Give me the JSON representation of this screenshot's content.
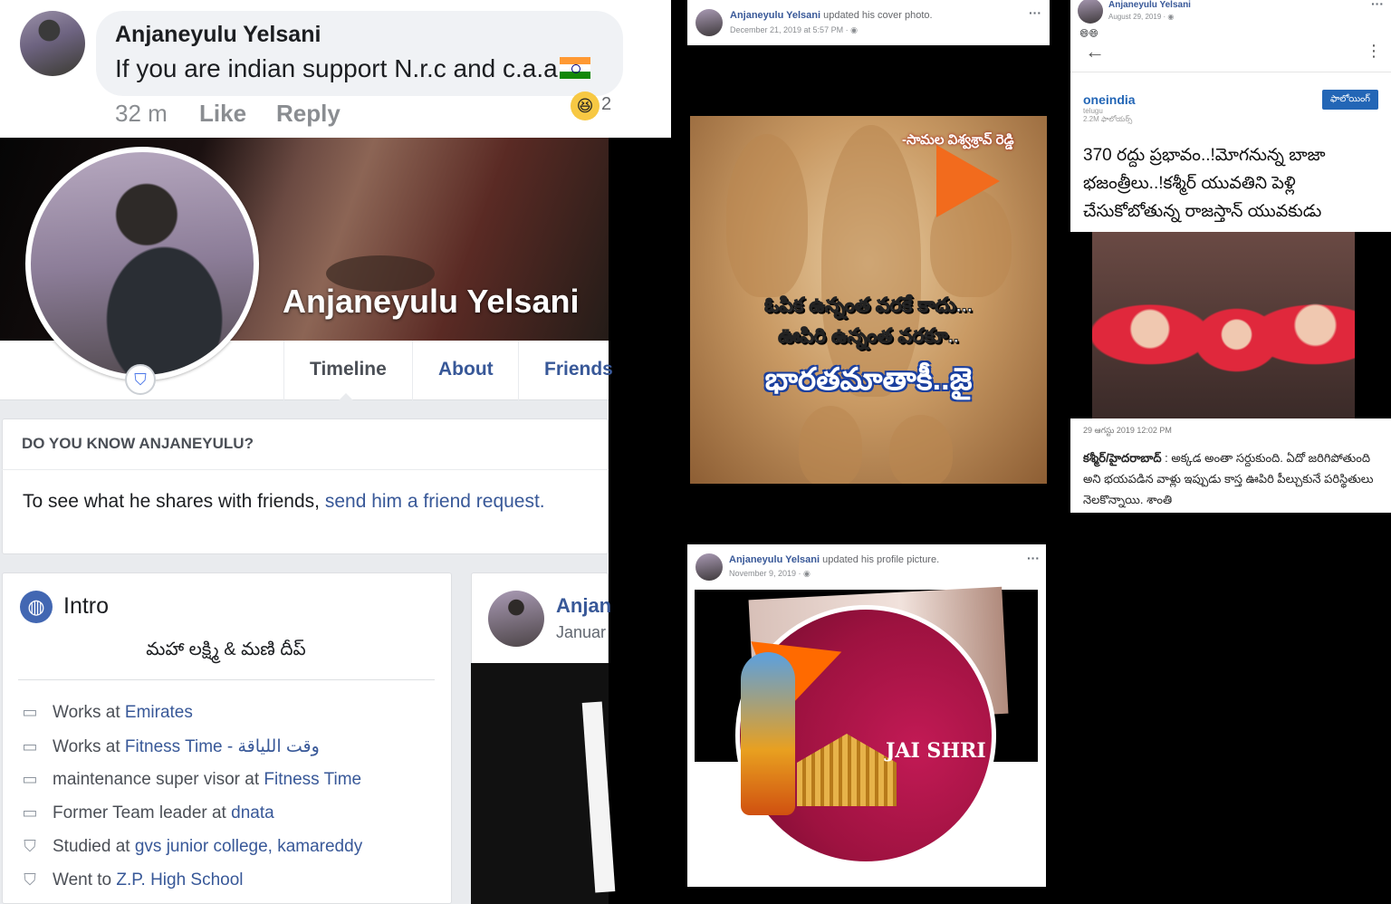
{
  "comment": {
    "author": "Anjaneyulu Yelsani",
    "text": "If you are indian support N.r.c and c.a.a",
    "time": "32 m",
    "like_label": "Like",
    "reply_label": "Reply",
    "reaction_emoji": "😆",
    "reaction_count": "2"
  },
  "profile": {
    "name": "Anjaneyulu Yelsani",
    "tabs": [
      {
        "label": "Timeline"
      },
      {
        "label": "About"
      },
      {
        "label": "Friends"
      }
    ],
    "do_you_know": {
      "heading": "DO YOU KNOW ANJANEYULU?",
      "text": "To see what he shares with friends, ",
      "link": "send him a friend request."
    },
    "intro": {
      "title": "Intro",
      "bio": "మహా లక్ష్మి & మణి దీప్",
      "items": [
        {
          "prefix": "Works at ",
          "link": "Emirates",
          "icon": "briefcase-icon"
        },
        {
          "prefix": "Works at ",
          "link": "Fitness Time - وقت اللياقة",
          "icon": "briefcase-icon"
        },
        {
          "prefix": "maintenance super visor at ",
          "link": "Fitness Time",
          "icon": "briefcase-icon"
        },
        {
          "prefix": "Former Team leader at ",
          "link": "dnata",
          "icon": "briefcase-icon"
        },
        {
          "prefix": "Studied at ",
          "link": "gvs junior college, kamareddy",
          "icon": "graduation-cap-icon"
        },
        {
          "prefix": "Went to ",
          "link": "Z.P. High School",
          "icon": "graduation-cap-icon"
        }
      ]
    },
    "post_preview": {
      "name": "Anjan",
      "date": "Januar"
    }
  },
  "cover_post": {
    "author": "Anjaneyulu Yelsani",
    "action": " updated his cover photo.",
    "date": "December 21, 2019 at 5:57 PM · ",
    "poster_credit": "-సామల విశ్వశ్రావ్ రెడ్డి",
    "poster_line1": "ఓపిక ఉన్నంత వరకే కాదు...",
    "poster_line2": "ఊపిరి ఉన్నంత వరకూ..",
    "poster_big": "భారతమాతాకీ..జై"
  },
  "profile_pic_post": {
    "author": "Anjaneyulu Yelsani",
    "action": " updated his profile picture.",
    "date": "November 9, 2019 · ",
    "image_text": "JAI SHRI"
  },
  "news_post": {
    "author": "Anjaneyulu Yelsani",
    "date": "August 29, 2019 · ",
    "emojis": "😄😄",
    "publisher": "oneindia",
    "publisher_sub": "telugu",
    "followers": "2.2M ఫాలోయర్స్",
    "follow_label": "ఫాలోయింగ్",
    "headline": "370 రద్దు ప్రభావం..!మోగనున్న బాజా భజంత్రీలు..!కశ్మీర్ యువతిని పెళ్లి చేసుకోబోతున్న రాజస్తాన్ యువకుడు",
    "article_date": "29 ఆగస్టు 2019 12:02 PM",
    "body_bold": "కశ్మీర్/హైదరాబాద్",
    "body": " : అక్కడ అంతా సర్దుకుంది. ఏదో జరిగిపోతుంది అని భయపడిన వాళ్లు ఇప్పుడు కాస్త ఊపిరి పీల్చుకునే పరిస్థితులు నెలకొన్నాయి. శాంతి"
  },
  "colors": {
    "facebook_link": "#385898",
    "facebook_blue": "#4267b2",
    "page_gray": "#e9ebee",
    "saffron": "#f26b1d",
    "oneindia_blue": "#2366b6"
  }
}
